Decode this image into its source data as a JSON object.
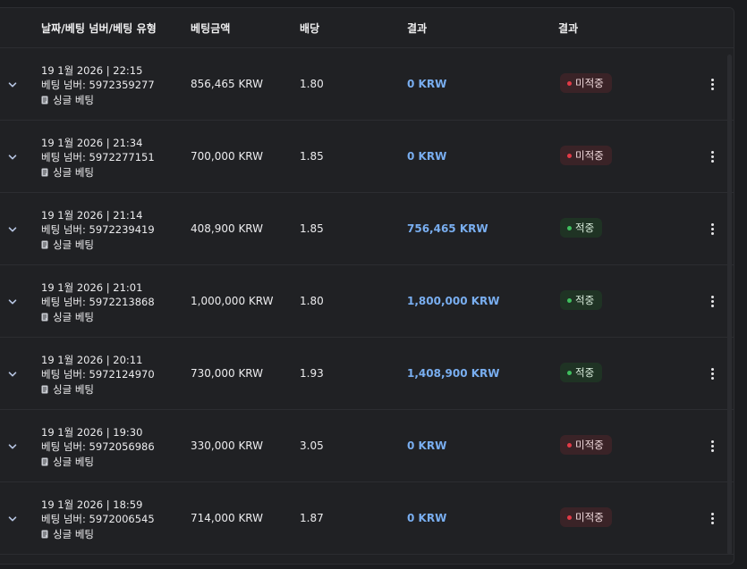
{
  "colors": {
    "background": "#1b1c1f",
    "panel": "#202124",
    "accent_result": "#79aef0",
    "lose_badge_bg": "#3a2327",
    "lose_dot": "#e23a46",
    "win_badge_bg": "#1f3324",
    "win_dot": "#3fbf5e"
  },
  "header": {
    "date_num_type": "날짜/베팅 넘버/베팅 유형",
    "amount": "베팅금액",
    "odds": "배당",
    "result": "결과",
    "status": "결과"
  },
  "rows": [
    {
      "date": "19 1월 2026 | 22:15",
      "number": "베팅 넘버: 5972359277",
      "type": "싱글 베팅",
      "amount": "856,465 KRW",
      "odds": "1.80",
      "result": "0 KRW",
      "status": "미적중",
      "win": false
    },
    {
      "date": "19 1월 2026 | 21:34",
      "number": "베팅 넘버: 5972277151",
      "type": "싱글 베팅",
      "amount": "700,000 KRW",
      "odds": "1.85",
      "result": "0 KRW",
      "status": "미적중",
      "win": false
    },
    {
      "date": "19 1월 2026 | 21:14",
      "number": "베팅 넘버: 5972239419",
      "type": "싱글 베팅",
      "amount": "408,900 KRW",
      "odds": "1.85",
      "result": "756,465 KRW",
      "status": "적중",
      "win": true
    },
    {
      "date": "19 1월 2026 | 21:01",
      "number": "베팅 넘버: 5972213868",
      "type": "싱글 베팅",
      "amount": "1,000,000 KRW",
      "odds": "1.80",
      "result": "1,800,000 KRW",
      "status": "적중",
      "win": true
    },
    {
      "date": "19 1월 2026 | 20:11",
      "number": "베팅 넘버: 5972124970",
      "type": "싱글 베팅",
      "amount": "730,000 KRW",
      "odds": "1.93",
      "result": "1,408,900 KRW",
      "status": "적중",
      "win": true
    },
    {
      "date": "19 1월 2026 | 19:30",
      "number": "베팅 넘버: 5972056986",
      "type": "싱글 베팅",
      "amount": "330,000 KRW",
      "odds": "3.05",
      "result": "0 KRW",
      "status": "미적중",
      "win": false
    },
    {
      "date": "19 1월 2026 | 18:59",
      "number": "베팅 넘버: 5972006545",
      "type": "싱글 베팅",
      "amount": "714,000 KRW",
      "odds": "1.87",
      "result": "0 KRW",
      "status": "미적중",
      "win": false
    }
  ],
  "icons": {
    "expand": "chevron-down-icon",
    "bet_type": "receipt-icon",
    "menu": "more-vertical-icon",
    "status": "status-dot-icon"
  }
}
